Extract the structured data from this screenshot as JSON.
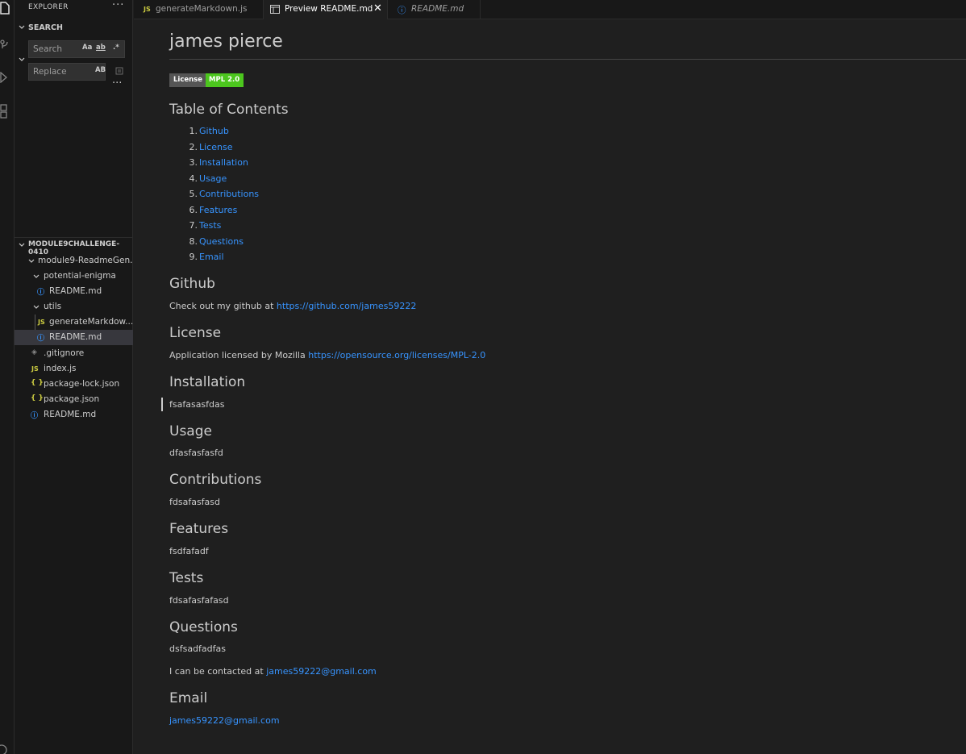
{
  "sidebar": {
    "explorer_title": "EXPLORER",
    "more": "···",
    "search_section": "SEARCH",
    "search_placeholder": "Search",
    "replace_placeholder": "Replace",
    "opt_case": "Aa",
    "opt_word": "ab",
    "opt_regex": ".*",
    "opt_preserve": "AB",
    "project_title": "MODULE9CHALLENGE-0410",
    "tree": [
      {
        "label": "module9-ReadmeGen...",
        "icon": "chevron-down-icon"
      },
      {
        "label": "potential-enigma",
        "icon": "chevron-down-icon"
      },
      {
        "label": "README.md",
        "icon": "info-icon"
      },
      {
        "label": "utils",
        "icon": "chevron-down-icon"
      },
      {
        "label": "generateMarkdow...",
        "icon": "js-icon"
      },
      {
        "label": "README.md",
        "icon": "info-icon"
      },
      {
        "label": ".gitignore",
        "icon": "git-icon"
      },
      {
        "label": "index.js",
        "icon": "js-icon"
      },
      {
        "label": "package-lock.json",
        "icon": "json-icon"
      },
      {
        "label": "package.json",
        "icon": "json-icon"
      },
      {
        "label": "README.md",
        "icon": "info-icon"
      }
    ]
  },
  "tabs": [
    {
      "label": "generateMarkdown.js",
      "icon": "js-icon",
      "active": false
    },
    {
      "label": "Preview README.md",
      "icon": "preview-icon",
      "active": true
    },
    {
      "label": "README.md",
      "icon": "info-icon",
      "active": false
    }
  ],
  "icons": {
    "js": "JS",
    "json": "{ }",
    "info": "ⓘ",
    "git": "◈",
    "close": "✕"
  },
  "colors": {
    "accent_link": "#3794ff",
    "badge_left": "#555555",
    "badge_right": "#4cc61e",
    "js_icon": "#cbcb41"
  },
  "preview": {
    "title": "james pierce",
    "badge_left": "License",
    "badge_right": "MPL 2.0",
    "toc_title": "Table of Contents",
    "toc": [
      {
        "num": "1.",
        "label": "Github"
      },
      {
        "num": "2.",
        "label": "License"
      },
      {
        "num": "3.",
        "label": "Installation"
      },
      {
        "num": "4.",
        "label": "Usage"
      },
      {
        "num": "5.",
        "label": "Contributions"
      },
      {
        "num": "6.",
        "label": "Features"
      },
      {
        "num": "7.",
        "label": "Tests"
      },
      {
        "num": "8.",
        "label": "Questions"
      },
      {
        "num": "9.",
        "label": "Email"
      }
    ],
    "github_heading": "Github",
    "github_text": "Check out my github at ",
    "github_link": "https://github.com/james59222",
    "license_heading": "License",
    "license_text": "Application licensed by Mozilla ",
    "license_link": "https://opensource.org/licenses/MPL-2.0",
    "installation_heading": "Installation",
    "installation_text": "fsafasasfdas",
    "usage_heading": "Usage",
    "usage_text": "dfasfasfasfd",
    "contributions_heading": "Contributions",
    "contributions_text": "fdsafasfasd",
    "features_heading": "Features",
    "features_text": "fsdfafadf",
    "tests_heading": "Tests",
    "tests_text": "fdsafasfafasd",
    "questions_heading": "Questions",
    "questions_text": "dsfsadfadfas",
    "contact_text": "I can be contacted at ",
    "contact_link": "james59222@gmail.com",
    "email_heading": "Email",
    "email_link": "james59222@gmail.com"
  }
}
